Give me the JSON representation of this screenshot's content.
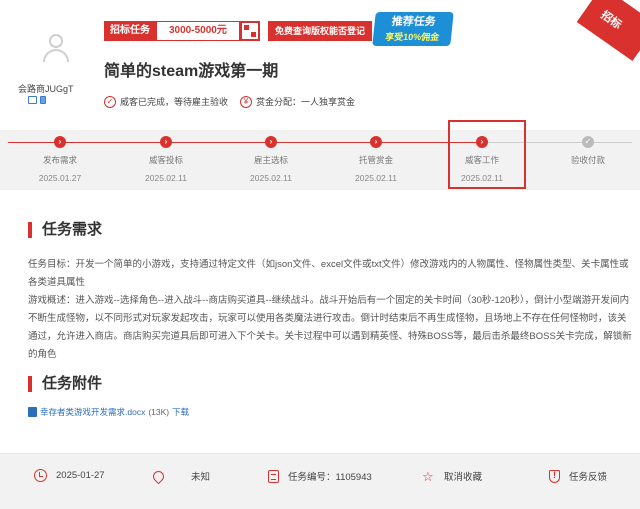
{
  "header": {
    "username": "会路商JUGgT",
    "tag_label": "招标任务",
    "price": "3000-5000元",
    "check_button": "免费查询版权能否登记",
    "promo_line1": "推荐任务",
    "promo_line2": "享受10%佣金",
    "corner_badge": "招标",
    "title": "简单的steam游戏第一期",
    "status_text": "威客已完成，等待雇主验收",
    "reward_text": "赏金分配：一人独享赏金"
  },
  "progress": {
    "steps": [
      {
        "label": "发布需求",
        "date": "2025.01.27",
        "state": "done"
      },
      {
        "label": "威客投标",
        "date": "2025.02.11",
        "state": "done"
      },
      {
        "label": "雇主选标",
        "date": "2025.02.11",
        "state": "done"
      },
      {
        "label": "托管赏金",
        "date": "2025.02.11",
        "state": "done"
      },
      {
        "label": "威客工作",
        "date": "2025.02.11",
        "state": "current"
      },
      {
        "label": "验收付款",
        "date": "",
        "state": "pending"
      }
    ]
  },
  "requirements": {
    "heading": "任务需求",
    "goal": "任务目标：开发一个简单的小游戏，支持通过特定文件（如json文件、excel文件或txt文件）修改游戏内的人物属性、怪物属性类型、关卡属性或各类道具属性",
    "overview": "游戏概述：进入游戏--选择角色--进入战斗--商店购买道具--继续战斗。战斗开始后有一个固定的关卡时间（30秒-120秒），倒计小型端游开发间内不断生成怪物，以不同形式对玩家发起攻击，玩家可以使用各类魔法进行攻击。倒计时结束后不再生成怪物，且场地上不存在任何怪物时，该关通过，允许进入商店。商店购买完道具后即可进入下个关卡。关卡过程中可以遇到精英怪、特殊BOSS等，最后击杀最终BOSS关卡完成，解锁新的角色"
  },
  "attachments": {
    "heading": "任务附件",
    "file_name": "幸存者类游戏开发需求.docx",
    "file_size": "(13K)",
    "download": "下载"
  },
  "footer": {
    "date": "2025-01-27",
    "location": "未知",
    "task_number": "任务编号：1105943",
    "cancel_favorite": "取消收藏",
    "feedback": "任务反馈"
  },
  "colors": {
    "accent": "#d9322e",
    "link": "#2a6ebb",
    "promo": "#1d8fd6"
  }
}
